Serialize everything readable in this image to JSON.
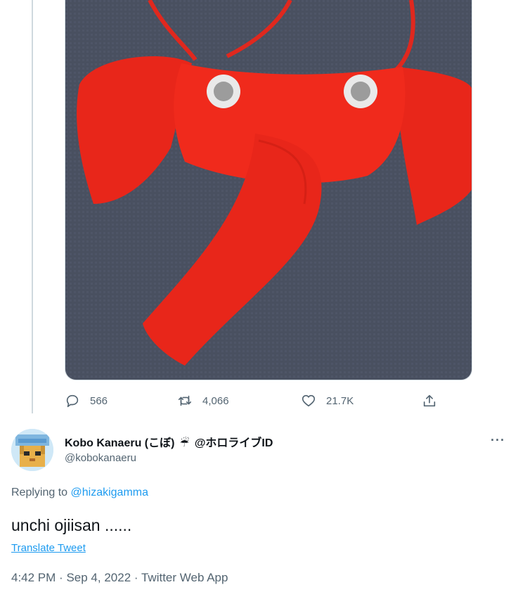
{
  "media": {
    "icon": "photo-image"
  },
  "actions": {
    "reply_count": "566",
    "retweet_count": "4,066",
    "like_count": "21.7K"
  },
  "reply_tweet": {
    "display_name": "Kobo Kanaeru (こぼ)",
    "name_emoji": "☔",
    "name_suffix": "@ホロライブID",
    "username": "@kobokanaeru",
    "more_label": "···",
    "replying_prefix": "Replying to",
    "replying_handle": "@hizakigamma",
    "text": "unchi ojiisan ......",
    "translate_label": "Translate Tweet",
    "time": "4:42 PM",
    "date": "Sep 4, 2022",
    "source": "Twitter Web App",
    "separator": "·"
  },
  "colors": {
    "accent": "#1d9bf0",
    "muted": "#536471",
    "text": "#0f1419"
  }
}
